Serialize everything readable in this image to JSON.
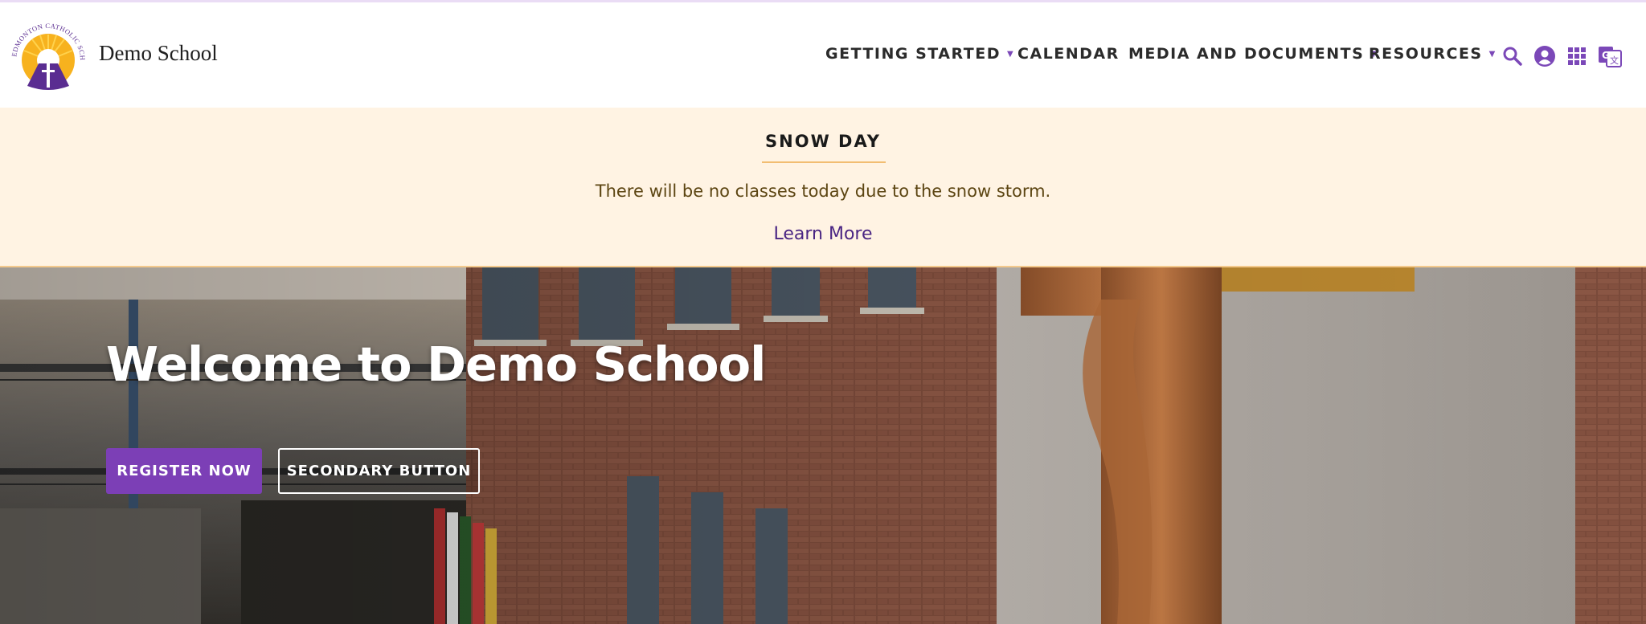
{
  "header": {
    "logo_text": "EDMONTON CATHOLIC SCHOOLS",
    "school_name": "Demo School",
    "nav": [
      {
        "label": "GETTING STARTED",
        "has_dropdown": true
      },
      {
        "label": "CALENDAR",
        "has_dropdown": false
      },
      {
        "label": "MEDIA AND DOCUMENTS",
        "has_dropdown": true
      },
      {
        "label": "RESOURCES",
        "has_dropdown": true
      }
    ],
    "icons": [
      "search-icon",
      "account-icon",
      "apps-grid-icon",
      "translate-icon"
    ],
    "accent_color": "#7b48b8"
  },
  "alert": {
    "title": "SNOW DAY",
    "message": "There will be no classes today due to the snow storm.",
    "link_label": "Learn More",
    "background": "#fff3e3"
  },
  "hero": {
    "title": "Welcome to Demo School",
    "primary_button": "REGISTER NOW",
    "secondary_button": "SECONDARY BUTTON",
    "primary_color": "#7c3fb6"
  }
}
